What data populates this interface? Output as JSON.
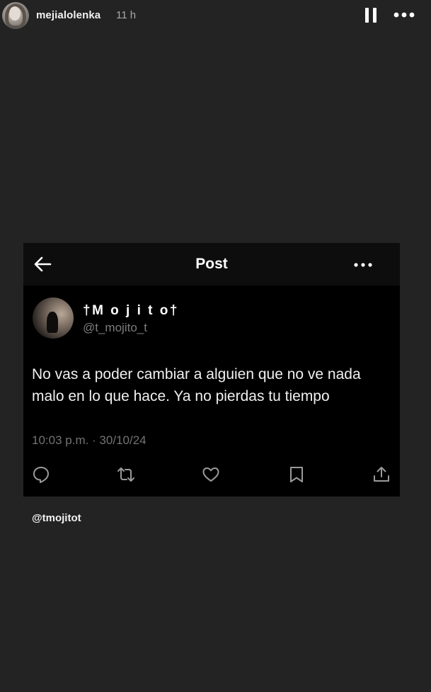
{
  "story": {
    "username": "mejialolenka",
    "time_ago": "11 h",
    "mention": "@tmojitot"
  },
  "post": {
    "header_title": "Post",
    "author_name": "†M o j i t o†",
    "author_handle": "@t_mojito_t",
    "text": "No vas a poder cambiar a alguien que no ve nada malo en lo que hace. Ya no pierdas tu tiempo",
    "timestamp": "10:03 p.m. · 30/10/24"
  },
  "icons": {
    "story": [
      "pause-icon",
      "more-icon"
    ],
    "post_header": [
      "back-arrow-icon",
      "more-icon"
    ],
    "actions": [
      "reply-icon",
      "repost-icon",
      "like-icon",
      "bookmark-icon",
      "share-icon"
    ]
  },
  "colors": {
    "story_background": "#232323",
    "post_background": "#000000",
    "muted_text": "#737373"
  }
}
